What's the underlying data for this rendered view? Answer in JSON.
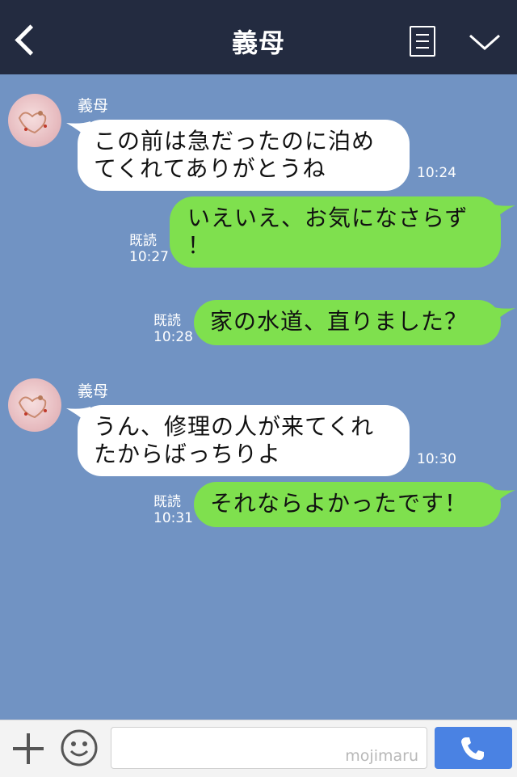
{
  "header": {
    "title": "義母"
  },
  "messages": [
    {
      "side": "in",
      "sender": "義母",
      "text": "この前は急だったのに泊め\nてくれてありがとうね",
      "time": "10:24"
    },
    {
      "side": "out",
      "text": "いえいえ、お気になさらず\n！",
      "read": "既読",
      "time": "10:27"
    },
    {
      "side": "out",
      "text": "家の水道、直りました？",
      "read": "既読",
      "time": "10:28"
    },
    {
      "side": "in",
      "sender": "義母",
      "text": "うん、修理の人が来てくれ\nたからばっちりよ",
      "time": "10:30"
    },
    {
      "side": "out",
      "text": "それならよかったです！",
      "read": "既読",
      "time": "10:31"
    }
  ],
  "footer": {
    "input_value": "",
    "watermark": "mojimaru"
  },
  "icons": {
    "back": "chevron-left-icon",
    "notes": "notes-icon",
    "menu": "chevron-down-icon",
    "plus": "plus-icon",
    "emoji": "smiley-icon",
    "call": "phone-icon"
  },
  "colors": {
    "header_bg": "#232b40",
    "chat_bg": "#7193c3",
    "incoming_bubble": "#ffffff",
    "outgoing_bubble": "#7fe04e",
    "call_button": "#4a82e3"
  }
}
